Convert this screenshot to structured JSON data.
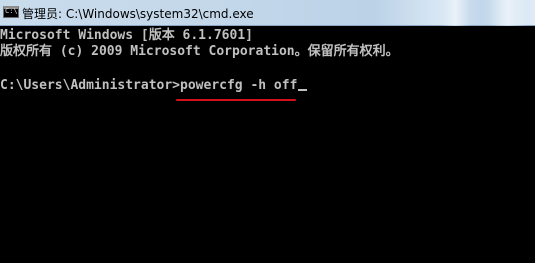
{
  "window": {
    "title": "管理员: C:\\Windows\\system32\\cmd.exe"
  },
  "console": {
    "lines": [
      "Microsoft Windows [版本 6.1.7601]",
      "版权所有 (c) 2009 Microsoft Corporation。保留所有权利。"
    ],
    "prompt": "C:\\Users\\Administrator>",
    "command": "powercfg -h off"
  },
  "colors": {
    "console_background": "#000000",
    "console_text": "#c0c0c0",
    "title_bar": "#c3d7ea",
    "annotation_underline": "#d4101a"
  },
  "icons": {
    "app": "cmd-console-icon"
  }
}
